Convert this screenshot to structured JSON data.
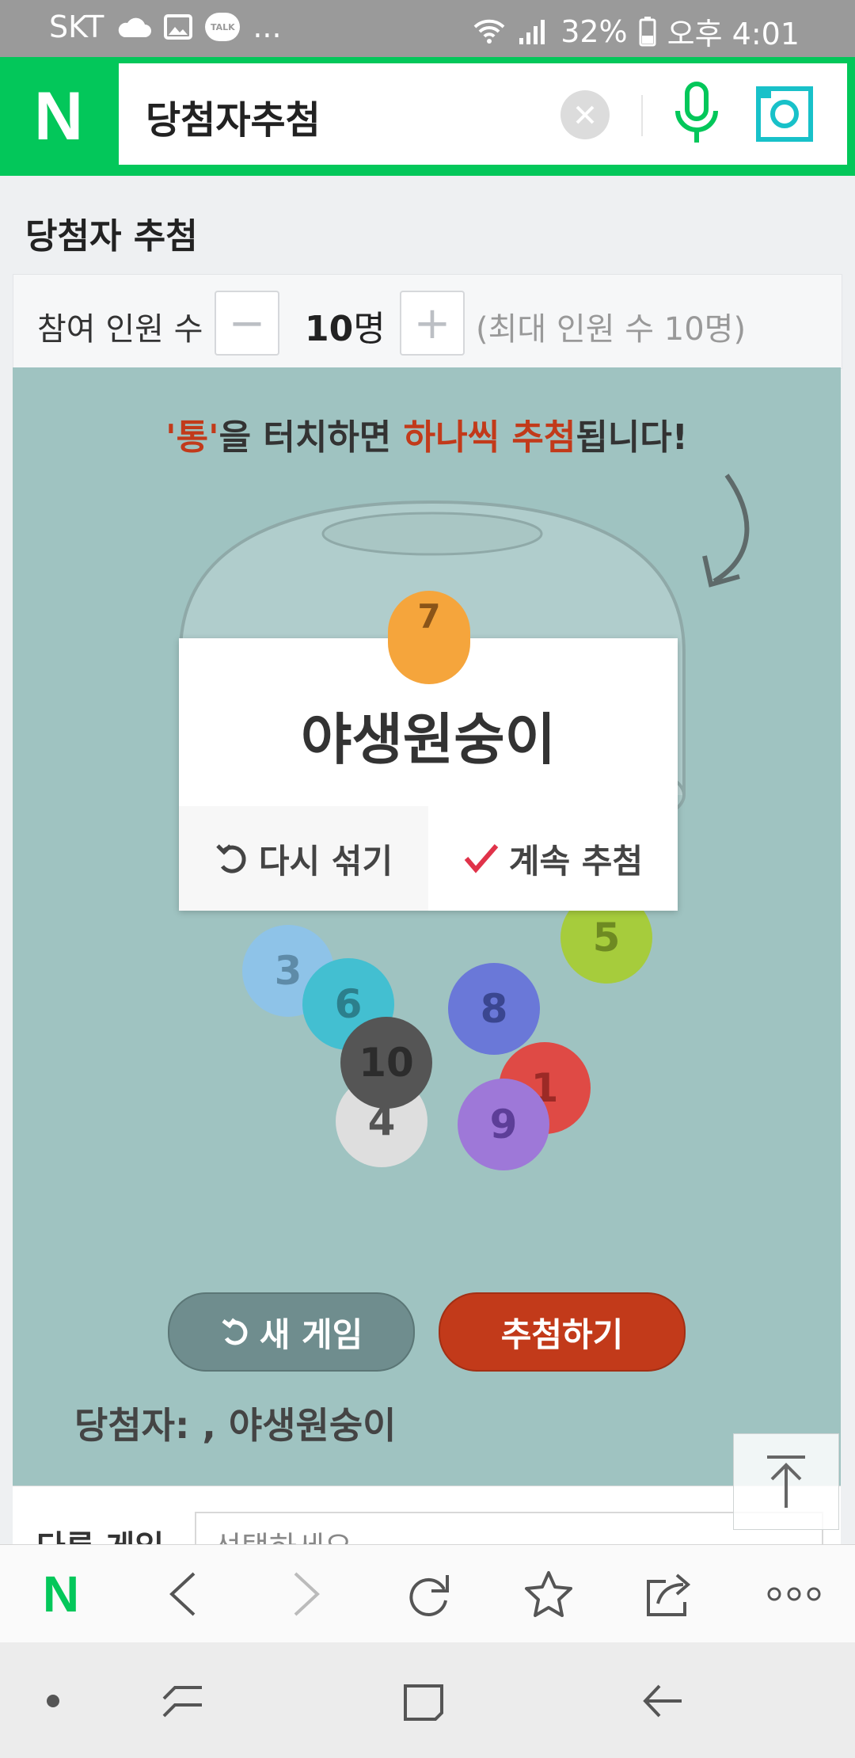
{
  "status_bar": {
    "carrier": "SKT",
    "more": "...",
    "battery": "32%",
    "time": "오후 4:01",
    "talk_badge": "TALK"
  },
  "search": {
    "logo": "N",
    "query": "당첨자추첨",
    "accent_color": "#03c75a"
  },
  "page_title": "당첨자 추첨",
  "participants": {
    "label": "참여 인원 수",
    "minus": "−",
    "plus": "+",
    "count": "10",
    "unit": "명",
    "max_note": "(최대 인원 수 10명)"
  },
  "game": {
    "hint_part1": "'통'",
    "hint_part2": "을 터치하면 ",
    "hint_part3": "하나씩 추첨",
    "hint_part4": "됩니다!",
    "drawn_ball_number": "7",
    "balls": [
      {
        "number": "3",
        "color": "#8ec3e8"
      },
      {
        "number": "5",
        "color": "#a6cc3c"
      },
      {
        "number": "6",
        "color": "#43bfd1"
      },
      {
        "number": "8",
        "color": "#6a78d8"
      },
      {
        "number": "10",
        "color": "#555555"
      },
      {
        "number": "1",
        "color": "#df4a45"
      },
      {
        "number": "4",
        "color": "#dedede"
      },
      {
        "number": "9",
        "color": "#9e78d8"
      }
    ],
    "popup": {
      "winner": "야생원숭이",
      "reshuffle": "다시 섞기",
      "continue": "계속 추첨"
    },
    "new_game": "새 게임",
    "draw": "추첨하기",
    "winners_line": "당첨자: , 야생원숭이"
  },
  "other_game": {
    "label": "다른 게임",
    "select_placeholder": "선택하세요"
  },
  "toolbar": {
    "home_logo": "N"
  }
}
